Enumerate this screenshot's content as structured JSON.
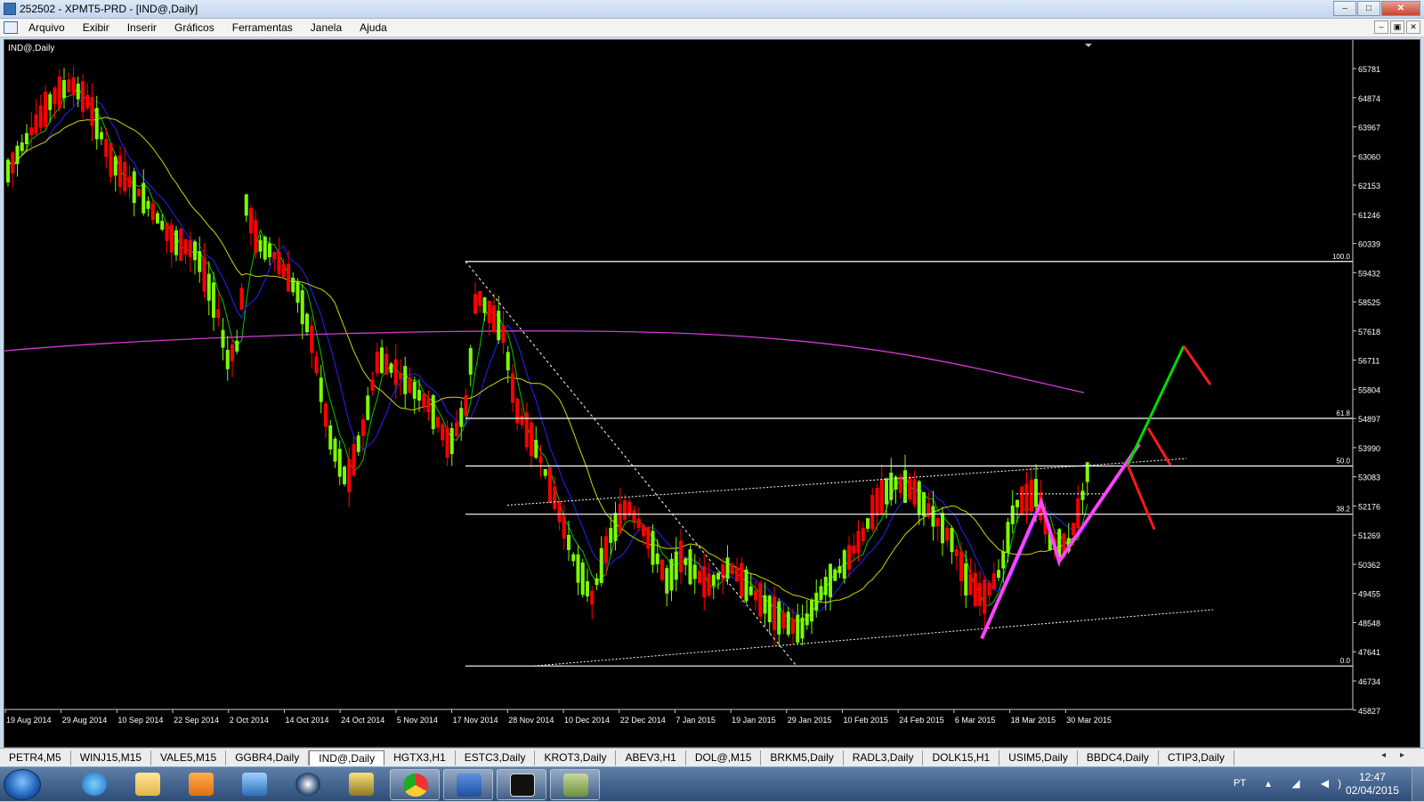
{
  "window": {
    "title": "252502 - XPMT5-PRD - [IND@,Daily]",
    "buttons": [
      "–",
      "□",
      "✕"
    ]
  },
  "menu": {
    "items": [
      "Arquivo",
      "Exibir",
      "Inserir",
      "Gráficos",
      "Ferramentas",
      "Janela",
      "Ajuda"
    ],
    "mdi_buttons": [
      "–",
      "▣",
      "✕"
    ]
  },
  "chart": {
    "symbol_label": "IND@,Daily",
    "price_axis": [
      "65781",
      "64874",
      "63967",
      "63060",
      "62153",
      "61246",
      "60339",
      "59432",
      "58525",
      "57618",
      "56711",
      "55804",
      "54897",
      "53990",
      "53083",
      "52176",
      "51269",
      "50362",
      "49455",
      "48548",
      "47641",
      "46734",
      "45827"
    ],
    "date_axis": [
      "19 Aug 2014",
      "29 Aug 2014",
      "10 Sep 2014",
      "22 Sep 2014",
      "2 Oct 2014",
      "14 Oct 2014",
      "24 Oct 2014",
      "5 Nov 2014",
      "17 Nov 2014",
      "28 Nov 2014",
      "10 Dec 2014",
      "22 Dec 2014",
      "7 Jan 2015",
      "19 Jan 2015",
      "29 Jan 2015",
      "10 Feb 2015",
      "24 Feb 2015",
      "6 Mar 2015",
      "18 Mar 2015",
      "30 Mar 2015"
    ],
    "fibonacci_levels": [
      {
        "label": "100.0",
        "price": 59780
      },
      {
        "label": "61.8",
        "price": 54900
      },
      {
        "label": "50.0",
        "price": 53420
      },
      {
        "label": "38.2",
        "price": 51920
      },
      {
        "label": "0.0",
        "price": 47200
      }
    ],
    "colors": {
      "background": "#000000",
      "bull_candle": "#7cfc00",
      "bear_candle": "#ff0000",
      "ma_fast": "#00c800",
      "ma_mid": "#2323ff",
      "ma_slow": "#d4d400",
      "ma_long": "#d23cd2",
      "projection_up": "#00dd00",
      "projection_down": "#ff1a1a",
      "pattern": "#ff44ff",
      "fib_line": "#ffffff"
    }
  },
  "symbol_tabs": [
    "PETR4,M5",
    "WINJ15,M15",
    "VALE5,M15",
    "GGBR4,Daily",
    "IND@,Daily",
    "HGTX3,H1",
    "ESTC3,Daily",
    "KROT3,Daily",
    "ABEV3,H1",
    "DOL@,M15",
    "BRKM5,Daily",
    "RADL3,Daily",
    "DOLK15,H1",
    "USIM5,Daily",
    "BBDC4,Daily",
    "CTIP3,Daily"
  ],
  "active_tab": "IND@,Daily",
  "taskbar": {
    "apps": [
      "internet-explorer-icon",
      "file-explorer-icon",
      "media-player-icon",
      "outlook-icon",
      "hp-icon",
      "archive-icon",
      "chrome-icon",
      "word-icon",
      "xp-icon",
      "metatrader-icon"
    ],
    "tray": {
      "language": "PT",
      "time": "12:47",
      "date": "02/04/2015"
    }
  }
}
